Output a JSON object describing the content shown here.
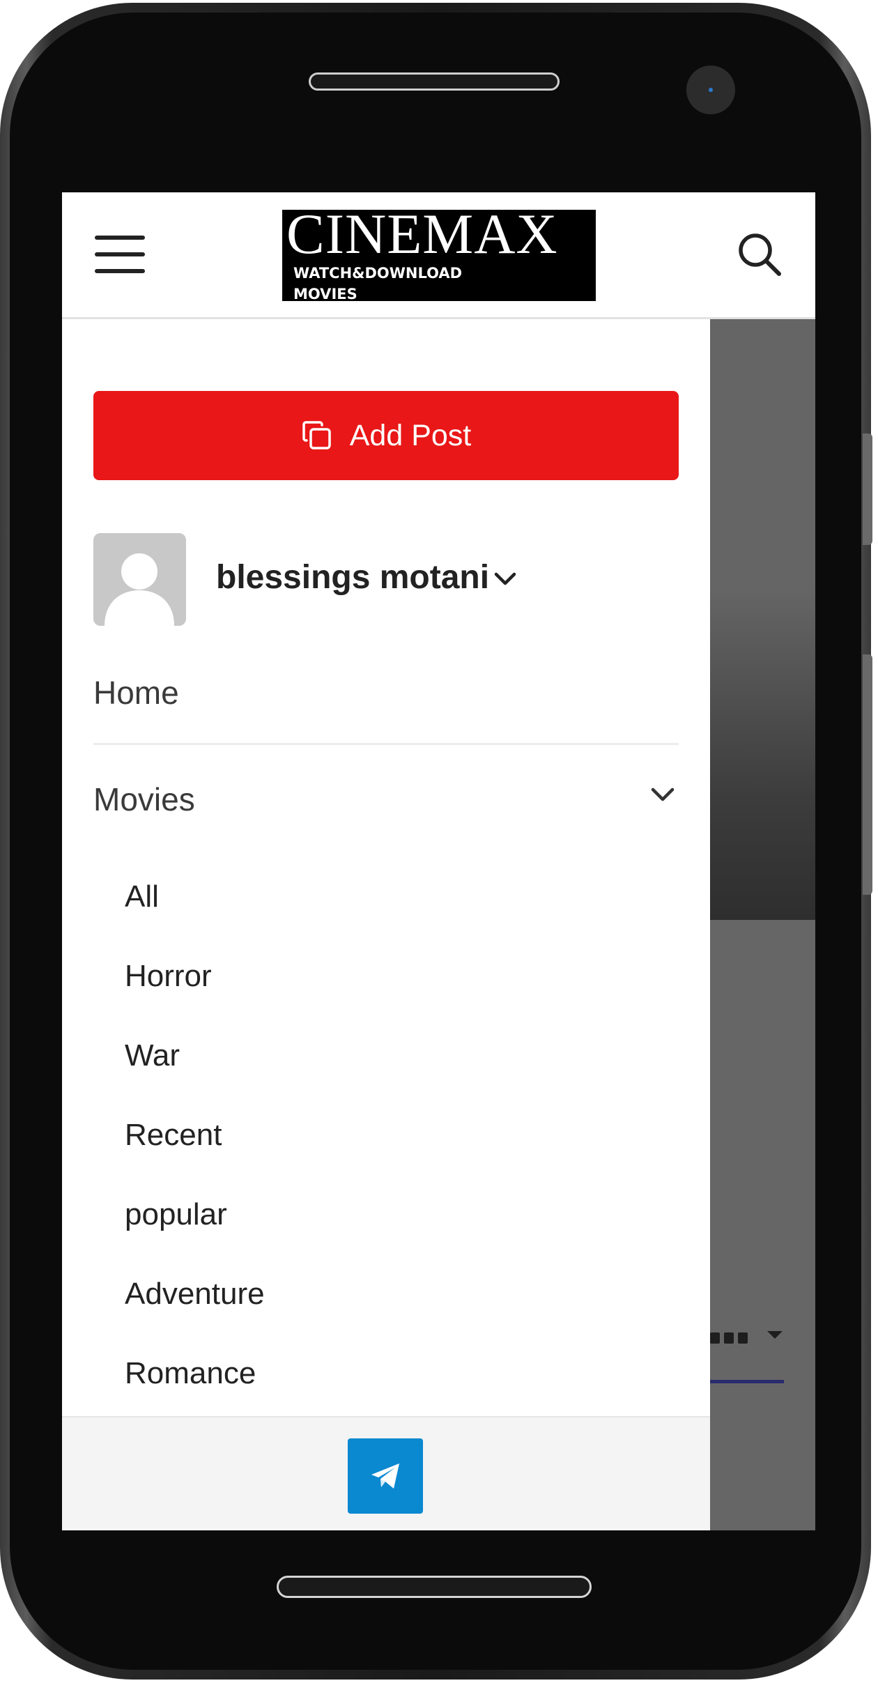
{
  "header": {
    "logo_title": "CINEMAX",
    "logo_subtitle": "WATCH&DOWNLOAD\nMOVIES",
    "menu_icon": "hamburger-menu-icon",
    "search_icon": "search-icon"
  },
  "drawer": {
    "add_post_label": "Add Post",
    "add_post_icon": "copy-icon",
    "user": {
      "name": "blessings motani",
      "avatar_icon": "default-avatar-icon"
    },
    "nav": {
      "home": "Home",
      "movies": "Movies",
      "movies_expanded": true,
      "movies_items": [
        "All",
        "Horror",
        "War",
        "Recent",
        "popular",
        "Adventure",
        "Romance"
      ]
    },
    "footer": {
      "telegram_icon": "telegram-icon"
    }
  },
  "colors": {
    "add_post_bg": "#e91717",
    "telegram_bg": "#0a88d0",
    "overlay": "#666666"
  }
}
